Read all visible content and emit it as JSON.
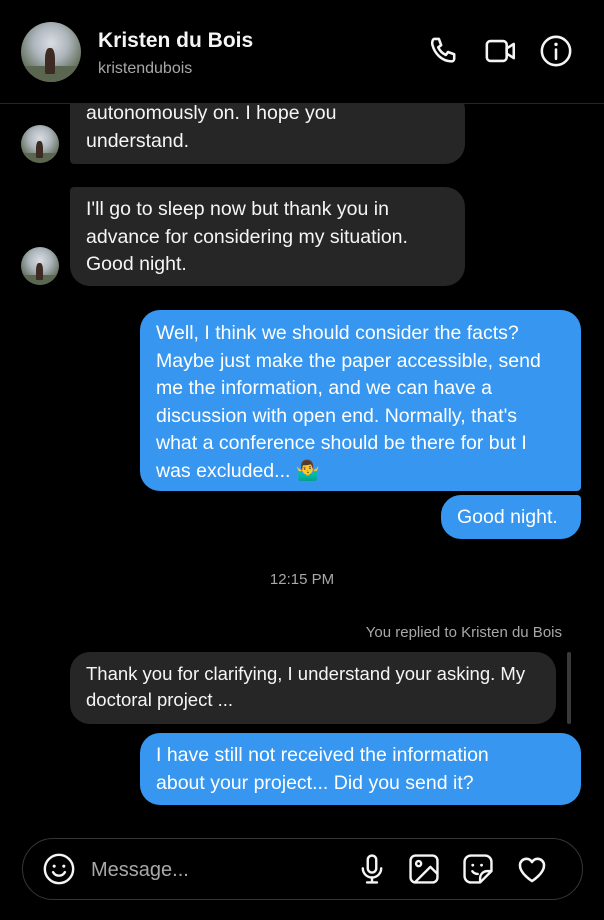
{
  "header": {
    "name": "Kristen du Bois",
    "username": "kristendubois",
    "icons": [
      "phone-icon",
      "video-camera-icon",
      "info-icon"
    ]
  },
  "messages": [
    {
      "from": "contact",
      "text": "autonomously on. I hope you\nunderstand."
    },
    {
      "from": "contact",
      "text": "I'll go to sleep now but thank you in\nadvance for considering my situation.\nGood night."
    },
    {
      "from": "me",
      "text": "Well, I think we should consider the facts?\nMaybe just make the paper accessible, send\nme the information, and we can have a\ndiscussion with open end. Normally, that's\nwhat a conference should be there for but I\nwas excluded... 🤷‍♂️"
    },
    {
      "from": "me",
      "text": "Good night."
    },
    {
      "from": "contact",
      "text": "Thank you for clarifying, I understand your asking. My\ndoctoral project ..."
    },
    {
      "from": "me",
      "text": "I have still not received the information\nabout your project... Did you send it?"
    }
  ],
  "timestamp": "12:15 PM",
  "reply_note": "You replied to Kristen du Bois",
  "composer": {
    "placeholder": "Message...",
    "icons": [
      "emoji-icon",
      "microphone-icon",
      "image-icon",
      "sticker-icon",
      "heart-icon"
    ]
  },
  "colors": {
    "background": "#000000",
    "incoming_bubble": "#262626",
    "outgoing_bubble": "#3797f0",
    "secondary_text": "#a8a8a8"
  }
}
